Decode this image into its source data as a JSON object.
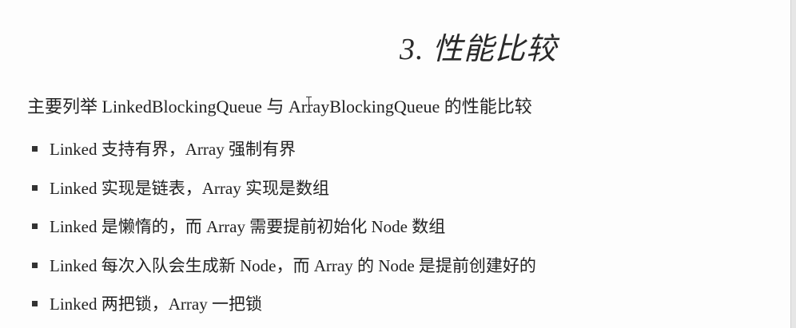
{
  "slide": {
    "heading": "3. 性能比较",
    "intro": "主要列举 LinkedBlockingQueue 与 ArrayBlockingQueue 的性能比较",
    "bullets": [
      "Linked 支持有界，Array 强制有界",
      "Linked 实现是链表，Array 实现是数组",
      "Linked 是懒惰的，而 Array 需要提前初始化 Node 数组",
      "Linked 每次入队会生成新 Node，而 Array 的 Node 是提前创建好的",
      "Linked 两把锁，Array 一把锁"
    ]
  }
}
